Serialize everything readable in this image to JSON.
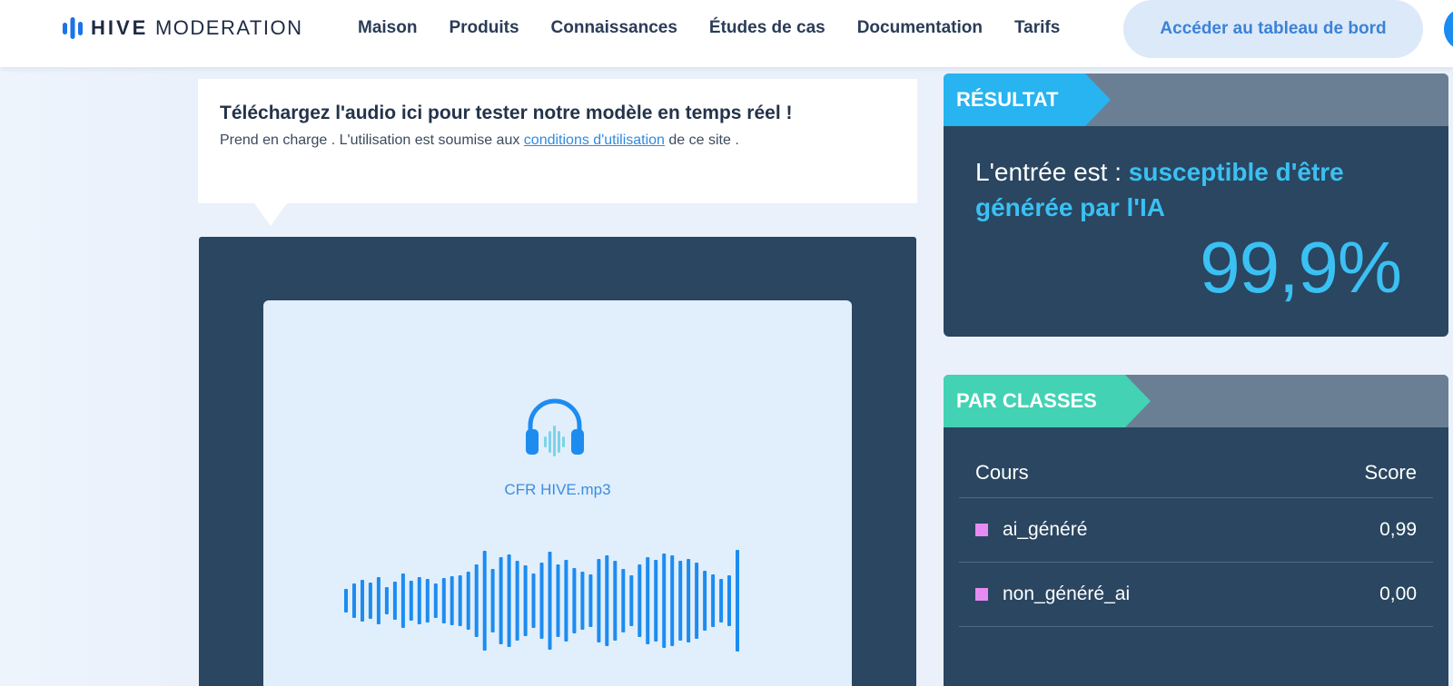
{
  "nav": {
    "logo": {
      "brand": "HIVE",
      "product": "MODERATION"
    },
    "links": [
      "Maison",
      "Produits",
      "Connaissances",
      "Études de cas",
      "Documentation",
      "Tarifs"
    ],
    "cta_label": "Accéder au tableau de bord"
  },
  "upload": {
    "title": "Téléchargez l'audio ici pour tester notre modèle en temps réel !",
    "sub_before": "Prend en charge . L'utilisation est soumise aux ",
    "sub_link": "conditions d'utilisation",
    "sub_after": "  de ce site  .",
    "filename": "CFR HIVE.mp3",
    "icon": "headphones-icon"
  },
  "result": {
    "tag": "RÉSULTAT",
    "verdict_prefix": "L'entrée est : ",
    "verdict_value": "susceptible d'être générée par l'IA",
    "score": "99,9%"
  },
  "classes": {
    "tag": "PAR CLASSES",
    "col_class": "Cours",
    "col_score": "Score",
    "rows": [
      {
        "name": "ai_généré",
        "score": "0,99",
        "color": "#e58cf2"
      },
      {
        "name": "non_généré_ai",
        "score": "0,00",
        "color": "#e58cf2"
      }
    ]
  },
  "colors": {
    "accent_blue": "#3bc0f3",
    "result_tag": "#27b4f0",
    "classes_tag": "#43d2b4",
    "panel_bg": "#2a4660",
    "link": "#2f8ae0"
  }
}
